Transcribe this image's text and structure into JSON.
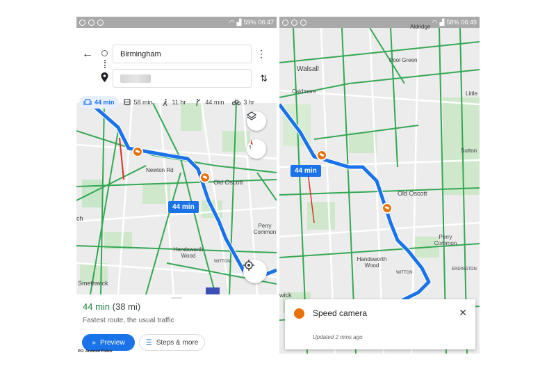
{
  "status_left": {
    "battery": "59%",
    "time": "06:47"
  },
  "status_right": {
    "battery": "58%",
    "time": "06:49"
  },
  "directions": {
    "origin": "Birmingham",
    "destination_placeholder": ""
  },
  "modes": [
    {
      "icon": "car-icon",
      "label": "44 min"
    },
    {
      "icon": "bus-icon",
      "label": "58 min"
    },
    {
      "icon": "walk-icon",
      "label": "11 hr"
    },
    {
      "icon": "rideshare-icon",
      "label": "44 min"
    },
    {
      "icon": "bike-icon",
      "label": "3 hr"
    }
  ],
  "left_map": {
    "route_label": "44 min",
    "places": {
      "newton_rd": "Newton Rd",
      "old_oscott": "Old Oscott",
      "perry_common": "Perry Common",
      "handsworth_wood": "Handsworth Wood",
      "smethwick": "Smethwick",
      "witton": "WITTON",
      "edge_h": "ch"
    }
  },
  "route_summary": {
    "time": "44 min",
    "distance": "(38 mi)",
    "description": "Fastest route, the usual traffic",
    "preview_label": "Preview",
    "steps_label": "Steps & more"
  },
  "credit": "PC: Android Police",
  "right_map": {
    "route_label": "44 min",
    "places": {
      "aldridge": "Aldridge",
      "walsall": "Walsall",
      "pool_green": "Pool Green",
      "caldmore": "Caldmore",
      "little": "Little",
      "sutton": "Sutton",
      "old_oscott": "Old Oscott",
      "perry_common": "Perry Common",
      "handsworth_wood": "Handsworth Wood",
      "witton": "WITTON",
      "erdington": "ERDINGTON",
      "edge_wick": "wick"
    }
  },
  "speed_camera_popup": {
    "title": "Speed camera",
    "updated": "Updated 2 mins ago"
  },
  "colors": {
    "route": "#1a73e8",
    "traffic_green": "#34a853",
    "camera": "#e8710a"
  }
}
